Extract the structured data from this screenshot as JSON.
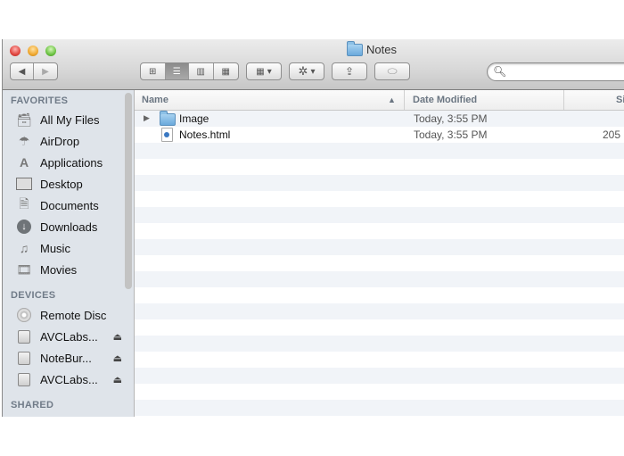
{
  "window": {
    "title": "Notes"
  },
  "toolbar": {
    "back_icon": "◀",
    "forward_icon": "▶",
    "view_icons": [
      "⊞",
      "☰",
      "▥",
      "▦"
    ],
    "arrange_icon": "▦",
    "action_icon": "✲",
    "dropdown_arrow": "▾",
    "share_icon": "⇪",
    "tags_icon": "⬭",
    "search_placeholder": "",
    "search_icon": "⚲"
  },
  "sidebar": {
    "favorites_heading": "FAVORITES",
    "favorites": [
      {
        "label": "All My Files",
        "icon": "all-files"
      },
      {
        "label": "AirDrop",
        "icon": "airdrop"
      },
      {
        "label": "Applications",
        "icon": "applications"
      },
      {
        "label": "Desktop",
        "icon": "desktop"
      },
      {
        "label": "Documents",
        "icon": "documents"
      },
      {
        "label": "Downloads",
        "icon": "downloads"
      },
      {
        "label": "Music",
        "icon": "music"
      },
      {
        "label": "Movies",
        "icon": "movies"
      }
    ],
    "devices_heading": "DEVICES",
    "devices": [
      {
        "label": "Remote Disc",
        "icon": "disc"
      },
      {
        "label": "AVCLabs...",
        "icon": "drive",
        "eject": "⏏"
      },
      {
        "label": "NoteBur...",
        "icon": "drive",
        "eject": "⏏"
      },
      {
        "label": "AVCLabs...",
        "icon": "drive",
        "eject": "⏏"
      }
    ],
    "shared_heading": "SHARED"
  },
  "columns": {
    "name": "Name",
    "sort_indicator": "▲",
    "date_modified": "Date Modified",
    "size": "Si"
  },
  "files": [
    {
      "name": "Image",
      "type": "folder",
      "date": "Today, 3:55 PM",
      "size": "",
      "disclosure": "▶"
    },
    {
      "name": "Notes.html",
      "type": "html",
      "date": "Today, 3:55 PM",
      "size": "205"
    }
  ]
}
